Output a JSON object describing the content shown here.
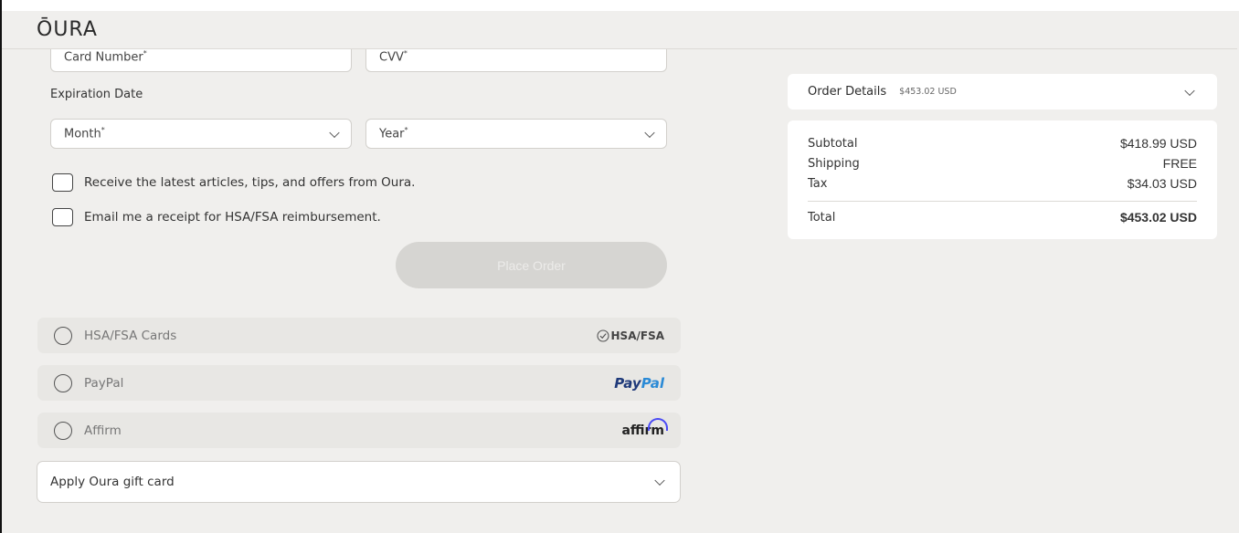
{
  "brand": {
    "logo": "ŌURA"
  },
  "payment_form": {
    "card_number_label": "Card Number",
    "cvv_label": "CVV",
    "required_mark": "*",
    "expiration_heading": "Expiration Date",
    "month_label": "Month",
    "year_label": "Year",
    "checkbox_marketing": "Receive the latest articles, tips, and offers from Oura.",
    "checkbox_hsa_receipt": "Email me a receipt for HSA/FSA reimbursement.",
    "place_order": "Place Order"
  },
  "payment_options": [
    {
      "label": "HSA/FSA Cards",
      "brand": "HSA/FSA",
      "icon": "check-circle-icon"
    },
    {
      "label": "PayPal",
      "brand_part1": "Pay",
      "brand_part2": "Pal"
    },
    {
      "label": "Affirm",
      "brand": "affirm"
    }
  ],
  "gift_card": {
    "label": "Apply Oura gift card"
  },
  "order": {
    "details_label": "Order Details",
    "details_amount": "$453.02 USD",
    "rows": [
      {
        "label": "Subtotal",
        "value": "$418.99 USD"
      },
      {
        "label": "Shipping",
        "value": "FREE"
      },
      {
        "label": "Tax",
        "value": "$34.03 USD"
      }
    ],
    "total_label": "Total",
    "total_value": "$453.02 USD"
  },
  "colors": {
    "background": "#f0efed",
    "disabled_button": "#d6d5d2",
    "paypal_dark": "#1f3a7a",
    "paypal_light": "#2a8ad6",
    "affirm_arc": "#4a4af4"
  }
}
